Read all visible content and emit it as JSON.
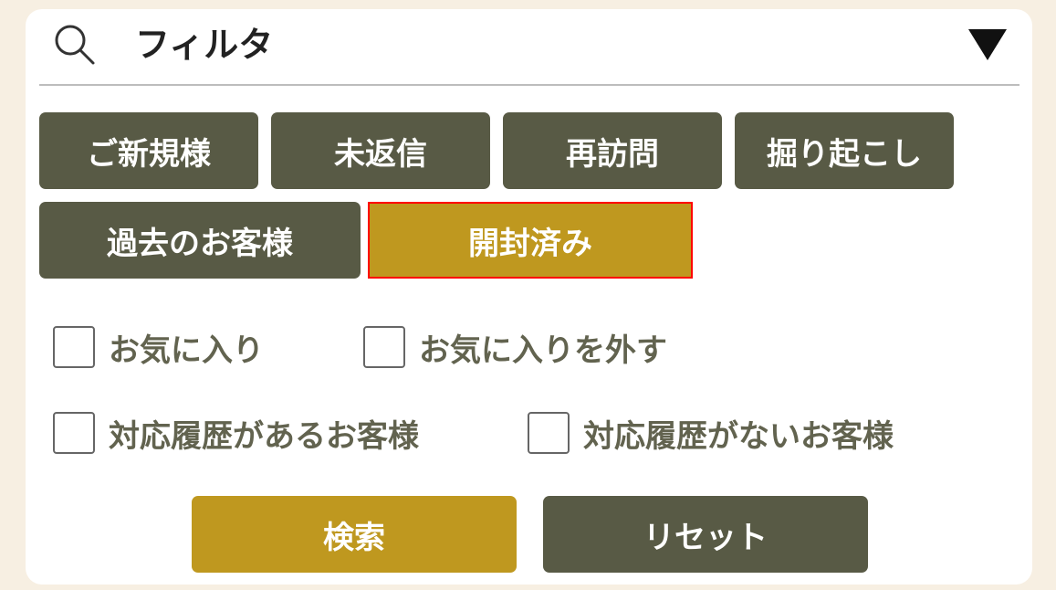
{
  "filter": {
    "title": "フィルタ",
    "search_icon": "search-icon",
    "toggle_icon": "triangle-down-icon"
  },
  "categories": [
    {
      "label": "ご新規様",
      "selected": false
    },
    {
      "label": "未返信",
      "selected": false
    },
    {
      "label": "再訪問",
      "selected": false
    },
    {
      "label": "掘り起こし",
      "selected": false
    },
    {
      "label": "過去のお客様",
      "selected": false
    },
    {
      "label": "開封済み",
      "selected": true
    }
  ],
  "checkboxes": [
    {
      "label": "お気に入り",
      "checked": false
    },
    {
      "label": "お気に入りを外す",
      "checked": false
    },
    {
      "label": "対応履歴があるお客様",
      "checked": false
    },
    {
      "label": "対応履歴がないお客様",
      "checked": false
    }
  ],
  "actions": {
    "search_label": "検索",
    "reset_label": "リセット"
  },
  "colors": {
    "background": "#f7efe2",
    "dark_button": "#585a45",
    "gold_button": "#bf981f",
    "selected_border": "#ff0000",
    "checkbox_text": "#62634f"
  }
}
